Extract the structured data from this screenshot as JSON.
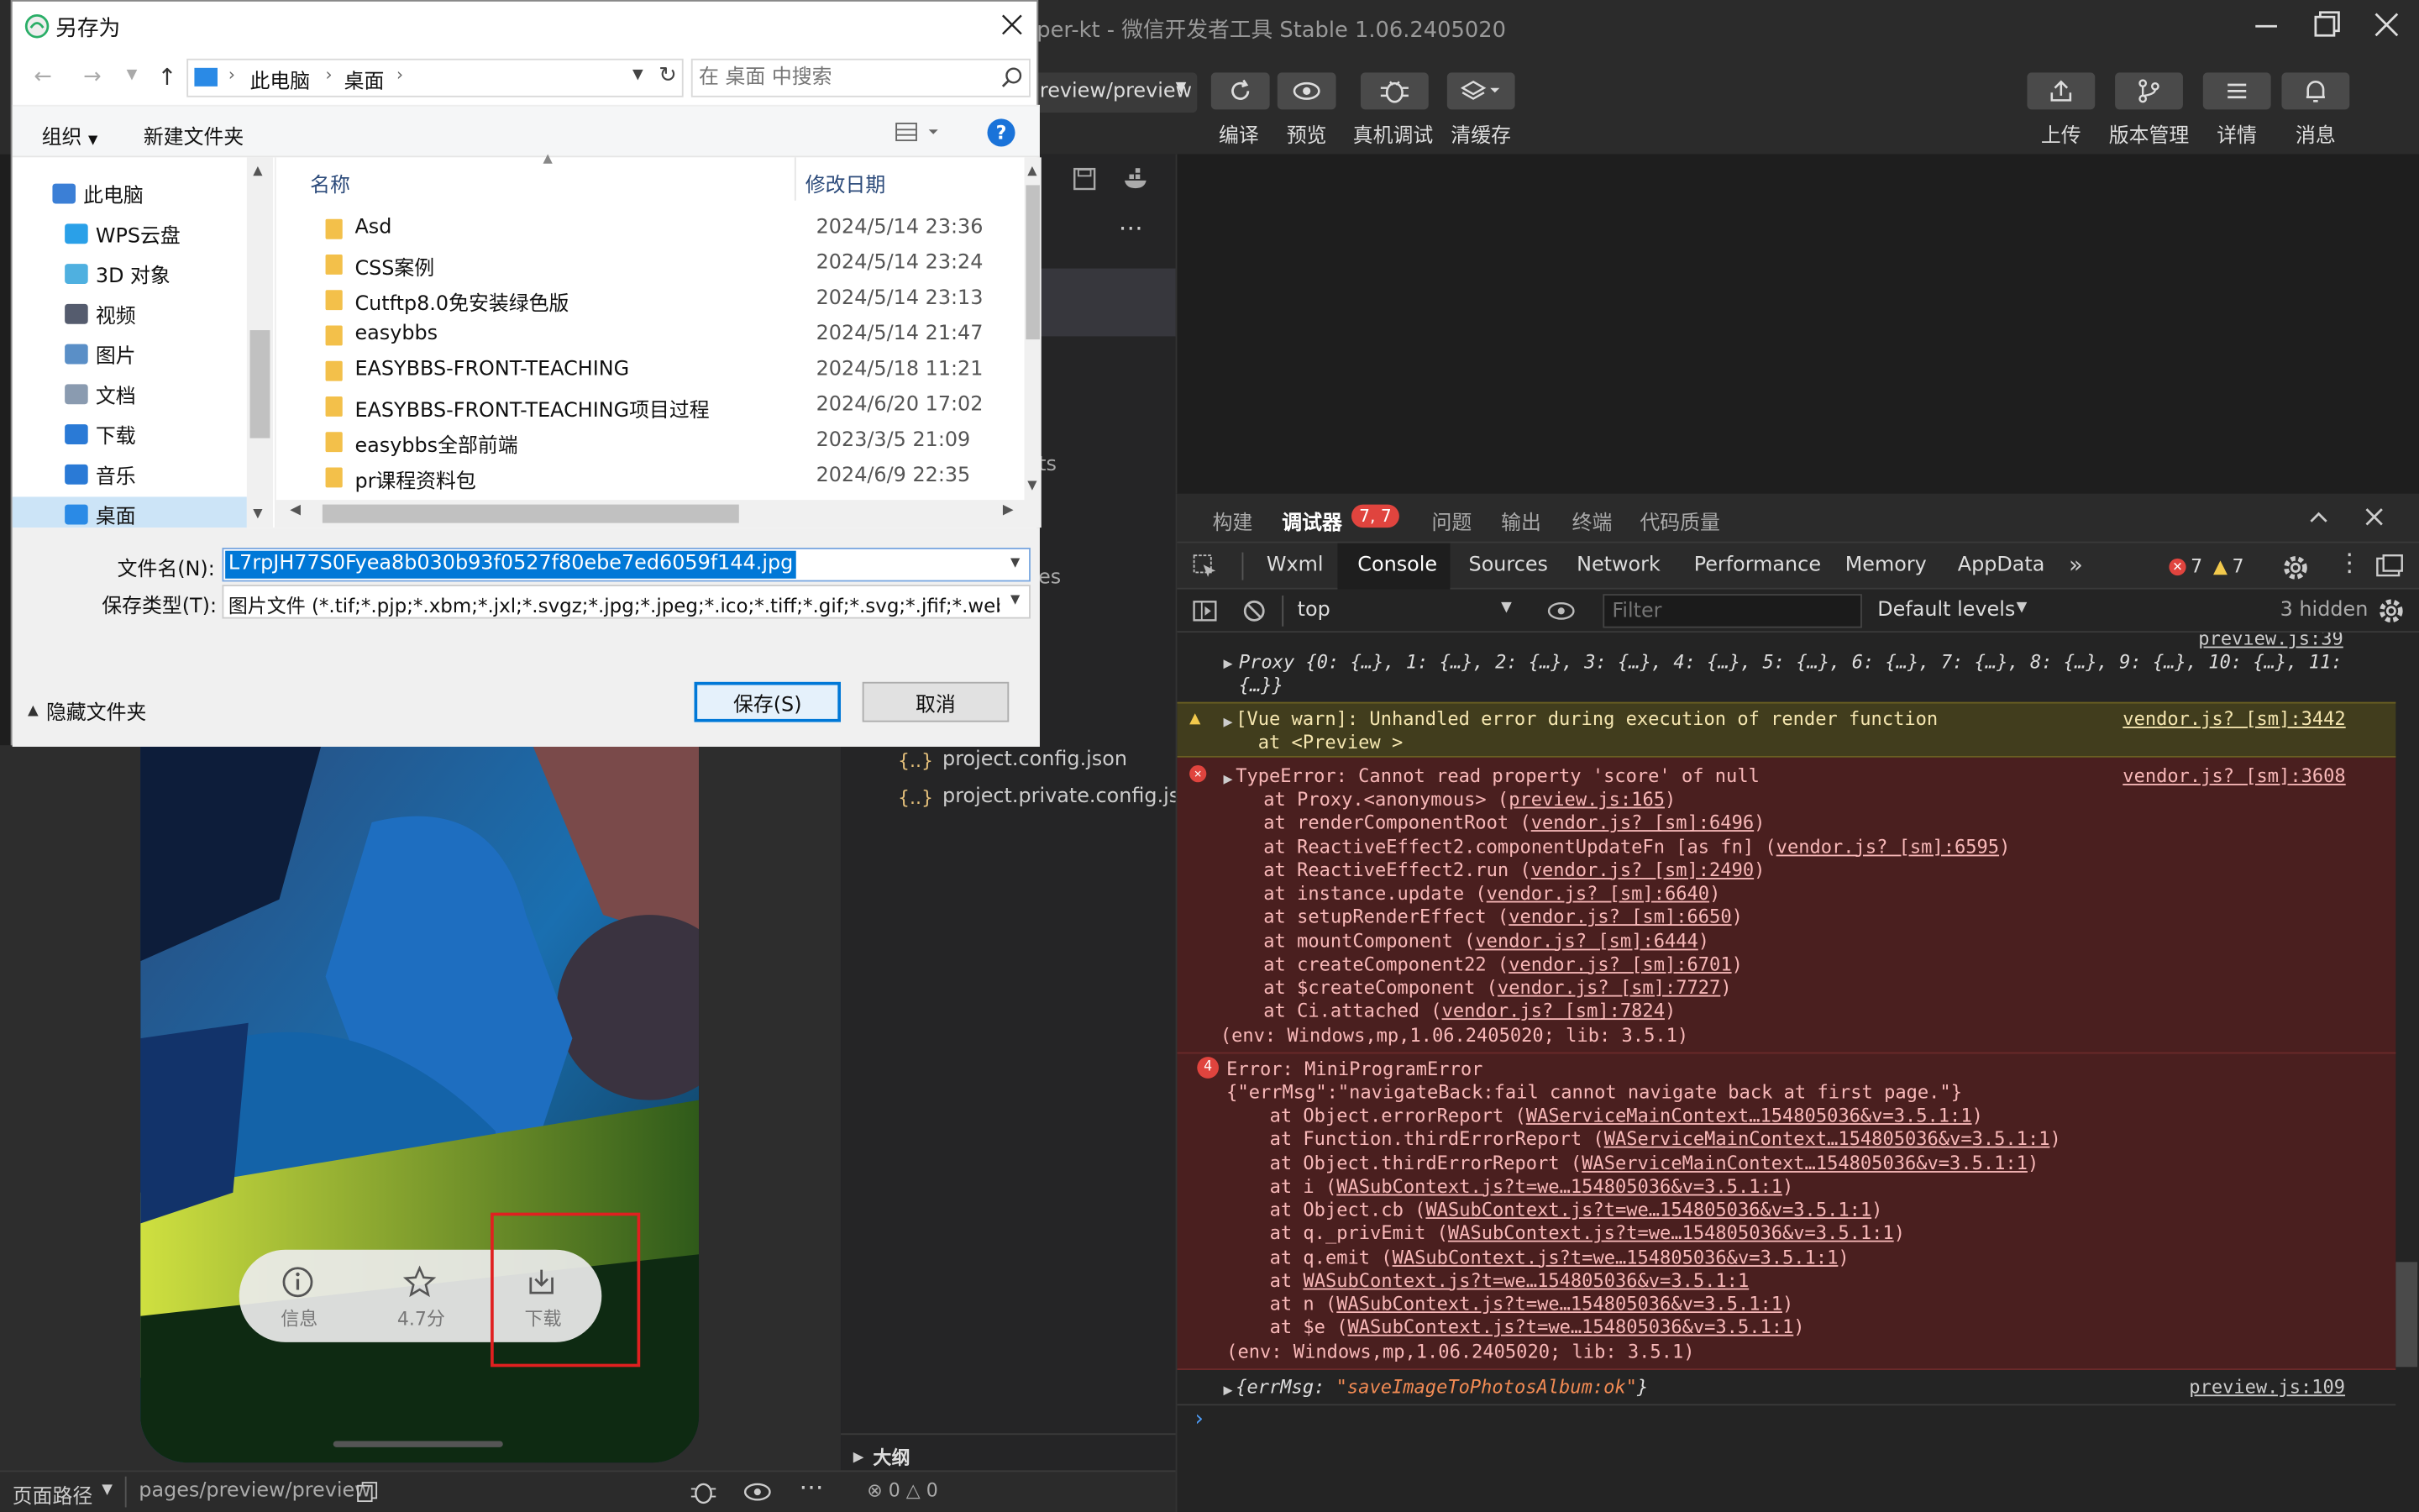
{
  "app": {
    "title": "per-kt - 微信开发者工具 Stable 1.06.2405020",
    "route_select": "review/preview"
  },
  "toolbar": [
    {
      "label": "编译",
      "icon": "refresh-icon"
    },
    {
      "label": "预览",
      "icon": "eye-icon"
    },
    {
      "label": "真机调试",
      "icon": "bug-icon"
    },
    {
      "label": "清缓存",
      "icon": "layers-icon"
    }
  ],
  "toolbar_right": [
    {
      "label": "上传",
      "icon": "upload-icon"
    },
    {
      "label": "版本管理",
      "icon": "branch-icon"
    },
    {
      "label": "详情",
      "icon": "menu-icon"
    },
    {
      "label": "消息",
      "icon": "bell-icon"
    }
  ],
  "editor": {
    "files": [
      "project.config.json",
      "project.private.config.js..."
    ],
    "outline": "大纲",
    "frag1": "ts",
    "frag2": "es"
  },
  "bottom_bar": {
    "path_label": "页面路径",
    "path": "pages/preview/preview",
    "errors": "0",
    "warnings": "0"
  },
  "phone": {
    "actions": [
      {
        "label": "信息",
        "icon": "info-icon"
      },
      {
        "label": "4.7分",
        "icon": "star-icon"
      },
      {
        "label": "下载",
        "icon": "download-icon"
      }
    ]
  },
  "devtools": {
    "panel_tabs": [
      "构建",
      "调试器",
      "问题",
      "输出",
      "终端",
      "代码质量"
    ],
    "debugger_badge": "7, 7",
    "tabs": [
      "Wxml",
      "Console",
      "Sources",
      "Network",
      "Performance",
      "Memory",
      "AppData"
    ],
    "error_count": "7",
    "warn_count": "7",
    "context": "top",
    "filter_placeholder": "Filter",
    "levels": "Default levels",
    "hidden": "3 hidden",
    "console": {
      "proxy_src": "preview.js:39",
      "proxy_line": "Proxy {0: {…}, 1: {…}, 2: {…}, 3: {…}, 4: {…}, 5: {…}, 6: {…}, 7: {…}, 8: {…}, 9: {…}, 10: {…}, 11:",
      "proxy_cont": "{…}}",
      "warn_line1": "[Vue warn]: Unhandled error during execution of render function",
      "warn_line2": "  at <Preview >",
      "warn_src": "vendor.js? [sm]:3442",
      "type_error": "TypeError: Cannot read property 'score' of null",
      "type_error_src": "vendor.js? [sm]:3608",
      "stack1": [
        {
          "fn": "at Proxy.<anonymous> (",
          "loc": "preview.js:165"
        },
        {
          "fn": "at renderComponentRoot (",
          "loc": "vendor.js? [sm]:6496"
        },
        {
          "fn": "at ReactiveEffect2.componentUpdateFn [as fn] (",
          "loc": "vendor.js? [sm]:6595"
        },
        {
          "fn": "at ReactiveEffect2.run (",
          "loc": "vendor.js? [sm]:2490"
        },
        {
          "fn": "at instance.update (",
          "loc": "vendor.js? [sm]:6640"
        },
        {
          "fn": "at setupRenderEffect (",
          "loc": "vendor.js? [sm]:6650"
        },
        {
          "fn": "at mountComponent (",
          "loc": "vendor.js? [sm]:6444"
        },
        {
          "fn": "at createComponent22 (",
          "loc": "vendor.js? [sm]:6701"
        },
        {
          "fn": "at $createComponent (",
          "loc": "vendor.js? [sm]:7727"
        },
        {
          "fn": "at Ci.attached (",
          "loc": "vendor.js? [sm]:7824"
        }
      ],
      "env1": "(env: Windows,mp,1.06.2405020; lib: 3.5.1)",
      "repeat": "4",
      "mp_error": "Error: MiniProgramError",
      "mp_msg": "{\"errMsg\":\"navigateBack:fail cannot navigate back at first page.\"}",
      "stack2": [
        {
          "fn": "at Object.errorReport (",
          "loc": "WAServiceMainContext…154805036&v=3.5.1:1"
        },
        {
          "fn": "at Function.thirdErrorReport (",
          "loc": "WAServiceMainContext…154805036&v=3.5.1:1"
        },
        {
          "fn": "at Object.thirdErrorReport (",
          "loc": "WAServiceMainContext…154805036&v=3.5.1:1"
        },
        {
          "fn": "at i (",
          "loc": "WASubContext.js?t=we…154805036&v=3.5.1:1"
        },
        {
          "fn": "at Object.cb (",
          "loc": "WASubContext.js?t=we…154805036&v=3.5.1:1"
        },
        {
          "fn": "at q._privEmit (",
          "loc": "WASubContext.js?t=we…154805036&v=3.5.1:1"
        },
        {
          "fn": "at q.emit (",
          "loc": "WASubContext.js?t=we…154805036&v=3.5.1:1"
        },
        {
          "fn": "at ",
          "loc": "WASubContext.js?t=we…154805036&v=3.5.1:1"
        },
        {
          "fn": "at n (",
          "loc": "WASubContext.js?t=we…154805036&v=3.5.1:1"
        },
        {
          "fn": "at $e (",
          "loc": "WASubContext.js?t=we…154805036&v=3.5.1:1"
        }
      ],
      "env2": "(env: Windows,mp,1.06.2405020; lib: 3.5.1)",
      "ok_key": "{errMsg: ",
      "ok_val": "\"saveImageToPhotosAlbum:ok\"",
      "ok_end": "}",
      "ok_src": "preview.js:109"
    }
  },
  "dialog": {
    "title": "另存为",
    "breadcrumb": [
      "此电脑",
      "桌面"
    ],
    "search_placeholder": "在 桌面 中搜索",
    "organize": "组织",
    "new_folder": "新建文件夹",
    "help": "?",
    "tree": [
      {
        "label": "此电脑",
        "icon": "computer-icon",
        "color": "#3b7fd6"
      },
      {
        "label": "WPS云盘",
        "icon": "cloud-icon",
        "color": "#2aa0e8"
      },
      {
        "label": "3D 对象",
        "icon": "cube-icon",
        "color": "#4fb0e0"
      },
      {
        "label": "视频",
        "icon": "video-icon",
        "color": "#555c6e"
      },
      {
        "label": "图片",
        "icon": "picture-icon",
        "color": "#5a8fc7"
      },
      {
        "label": "文档",
        "icon": "document-icon",
        "color": "#8a9bb0"
      },
      {
        "label": "下载",
        "icon": "download-arrow-icon",
        "color": "#2a7ad6"
      },
      {
        "label": "音乐",
        "icon": "music-icon",
        "color": "#2a7ad6"
      },
      {
        "label": "桌面",
        "icon": "desktop-icon",
        "color": "#2a8ae6"
      }
    ],
    "col_name": "名称",
    "col_date": "修改日期",
    "files": [
      {
        "name": "Asd",
        "date": "2024/5/14 23:36"
      },
      {
        "name": "CSS案例",
        "date": "2024/5/14 23:24"
      },
      {
        "name": "Cutftp8.0免安装绿色版",
        "date": "2024/5/14 23:13"
      },
      {
        "name": "easybbs",
        "date": "2024/5/14 21:47"
      },
      {
        "name": "EASYBBS-FRONT-TEACHING",
        "date": "2024/5/18 11:21"
      },
      {
        "name": "EASYBBS-FRONT-TEACHING项目过程",
        "date": "2024/6/20 17:02"
      },
      {
        "name": "easybbs全部前端",
        "date": "2023/3/5 21:09"
      },
      {
        "name": "pr课程资料包",
        "date": "2024/6/9 22:35"
      }
    ],
    "filename_label": "文件名(N):",
    "filename_value": "L7rpJH77S0Fyea8b030b93f0527f80ebe7ed6059f144.jpg",
    "filetype_label": "保存类型(T):",
    "filetype_value": "图片文件 (*.tif;*.pjp;*.xbm;*.jxl;*.svgz;*.jpg;*.jpeg;*.ico;*.tiff;*.gif;*.svg;*.jfif;*.webp;*.p",
    "hide_folders": "隐藏文件夹",
    "save": "保存(S)",
    "cancel": "取消"
  }
}
